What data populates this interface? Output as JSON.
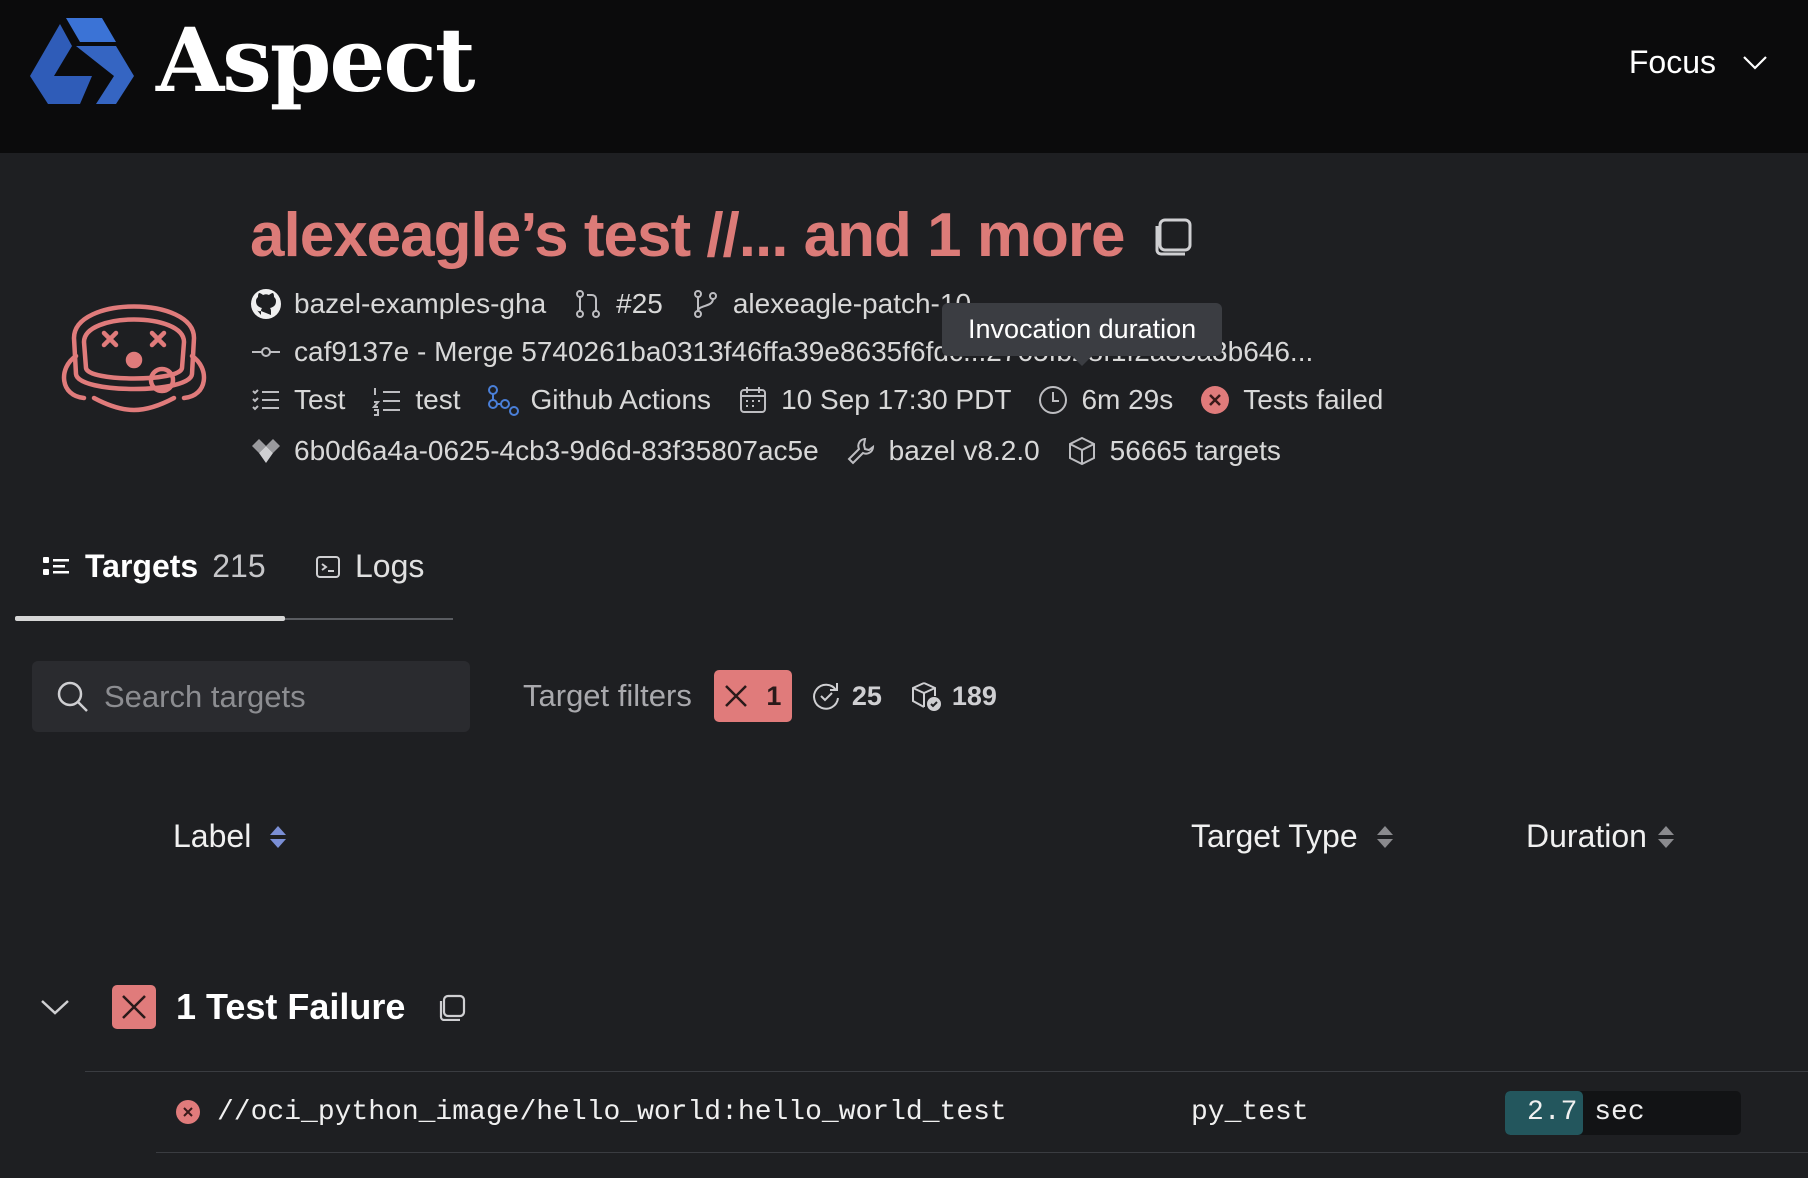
{
  "header": {
    "brand": "Aspect",
    "focus_label": "Focus"
  },
  "invocation": {
    "title": "alexeagle’s test //... and 1 more",
    "repo": "bazel-examples-gha",
    "pr": "#25",
    "branch": "alexeagle-patch-10",
    "commit": "caf9137e - Merge 5740261ba0313f46ffa39e8635f6fdc...2765fb28f1f2a83a3b646...",
    "command": "Test",
    "role": "test",
    "ci": "Github Actions",
    "date": "10 Sep 17:30 PDT",
    "duration": "6m 29s",
    "status": "Tests failed",
    "invocation_id": "6b0d6a4a-0625-4cb3-9d6d-83f35807ac5e",
    "bazel_version": "bazel v8.2.0",
    "targets_count": "56665 targets"
  },
  "tooltip": "Invocation duration",
  "tabs": [
    {
      "label": "Targets",
      "count": "215",
      "active": true
    },
    {
      "label": "Logs"
    }
  ],
  "search": {
    "placeholder": "Search targets"
  },
  "filters": {
    "label": "Target filters",
    "failed": "1",
    "cached": "25",
    "built": "189"
  },
  "table": {
    "col_label": "Label",
    "col_type": "Target Type",
    "col_duration": "Duration"
  },
  "group": {
    "title": "1 Test Failure"
  },
  "rows": [
    {
      "label": "//oci_python_image/hello_world:hello_world_test",
      "type": "py_test",
      "duration_value": "2.7",
      "duration_unit": "sec",
      "duration_fraction": 0.33
    }
  ],
  "colors": {
    "accent_red": "#dc7b78",
    "brand_blue": "#3b73d6",
    "duration_fill": "#23565d",
    "background": "#1e1f22"
  }
}
